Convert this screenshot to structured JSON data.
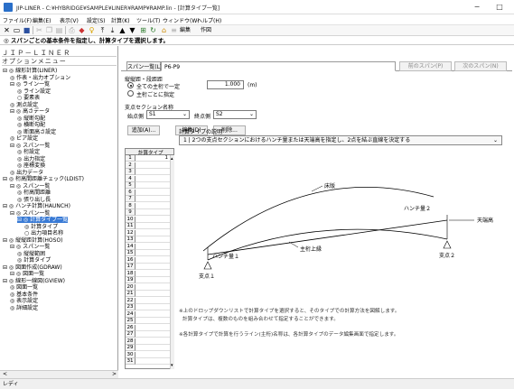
{
  "window": {
    "title": "JIP-LINER - C:¥HYBRIDGE¥SAMPLE¥LINER¥RAMP¥RAMP.lin - [計算タイプ一覧]",
    "minimize": "−",
    "maximize": "□"
  },
  "menu": [
    "ファイル(F)",
    "編集(E)",
    "表示(V)",
    "設定(S)",
    "計算(K)",
    "ツール(T)",
    "ウィンドウ(W)",
    "ヘルプ(H)"
  ],
  "toolbar": {
    "edit_label": "編集",
    "action_label": "作図"
  },
  "instruction": "◎ スパンごとの基本条件を指定し、計算タイプを選択します。",
  "left": {
    "title": "ＪＩＰ－ＬＩＮＥＲ",
    "subtitle": "オプションメニュー",
    "tree": [
      "⊟ ◎ 線形計算(LINER)",
      "◎ 作表・出力オプション",
      "⊟ ◎ ライン一覧",
      "◎ ライン設定",
      "○ 要素表",
      "◎ 測点設定",
      "⊟ ◎ 高さデータ",
      "◎ 縦断勾配",
      "◎ 横断勾配",
      "◎ 断面高さ設定",
      "◎ ピア設定",
      "⊟ ◎ スパン一覧",
      "◎ 桁設定",
      "◎ 出力指定",
      "◎ 座標変換",
      "◎ 出力データ",
      "⊟ ◎ 桁高間距離チェック(LDIST)",
      "⊟ ◎ スパン一覧",
      "◎ 桁高間距離",
      "◎ 張り出し長",
      "⊟ ◎ ハンチ計算(HAUNCH)",
      "⊟ ◎ スパン一覧",
      "⊟ ◎ 計算タイプ一覧",
      "◎ 計算タイプ",
      "○ 出力項目名称",
      "⊟ ◎ 縦縦距計算(HOSO)",
      "⊟ ◎ スパン一覧",
      "◎ 縦縦範囲",
      "◎ 計算タイプ",
      "⊟ ◎ 図面作成(GDRAW)",
      "⊟ ◎ 図面一覧",
      "⊟ ◎ 線形一線図(GVIEW)",
      "◎ 図面一覧",
      "◎ 基本条件",
      "◎ 表示設定",
      "◎ 詳細設定"
    ],
    "selected_index": 22,
    "scroll_left": "<",
    "scroll_right": ">"
  },
  "tabs": {
    "span_list": "スパン一覧(L)",
    "current": "P6-P9",
    "prev": "前のスパン(P)",
    "next": "次のスパン(N)"
  },
  "span_form": {
    "heading": "縦縦距・段距距",
    "radio_all": "全ての主桁で一定",
    "radio_each": "主桁ごとに指定",
    "value": "1.000",
    "unit": "(m)",
    "section_label": "支点セクション名称",
    "start_label": "始点側",
    "start_value": "S1",
    "end_label": "終点側",
    "end_value": "S2",
    "add_btn": "追加(A)...",
    "edit_btn": "編集(D)",
    "delete_btn": "削除..."
  },
  "grid": {
    "header": "計算タイプ",
    "rows": [
      "1",
      "2",
      "3",
      "4",
      "5",
      "6",
      "7",
      "8",
      "9",
      "10",
      "11",
      "12",
      "13",
      "14",
      "15",
      "16",
      "17",
      "18",
      "19",
      "20",
      "21",
      "22",
      "23",
      "24",
      "25",
      "26",
      "27",
      "28",
      "29",
      "30",
      "31"
    ],
    "first_value": "1"
  },
  "description": {
    "label": "計算タイプの説明",
    "selected": "1 | 2つの支点セクションにおけるハンチ量または天端高を指定し、2点を結ぶ直線を決定する"
  },
  "diagram": {
    "floor": "床版",
    "haunch1": "ハンチ量１",
    "haunch2": "ハンチ量２",
    "top": "天端高",
    "main_upper": "主桁上縁",
    "support1": "支点１",
    "support2": "支点２"
  },
  "notes": [
    "※上のドロップダウンリストで計算タイプを選択すると、そのタイプでの計算方法を図解します。",
    "計算タイプは、複数のものを組み合わせて指定することができます。",
    "※各計算タイプで計算を行うライン(主桁)名称は、各計算タイプのデータ編集画面で指定します。"
  ],
  "status": "レディ"
}
